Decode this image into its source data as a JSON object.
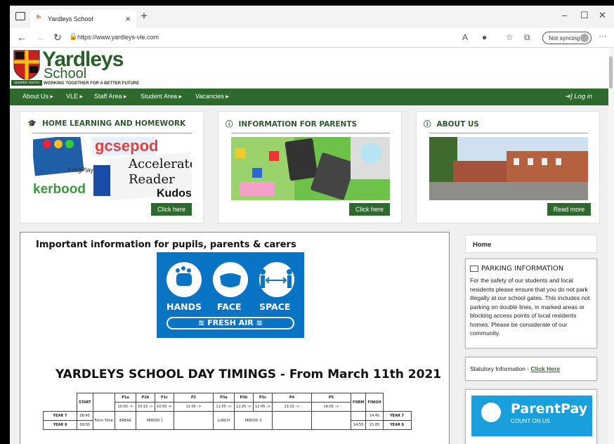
{
  "browser": {
    "tab_title": "Yardleys School",
    "url": "https://www.yardleys-vle.com",
    "sync_label": "Not syncing"
  },
  "site": {
    "brand_line1": "Yardleys",
    "brand_line2": "School",
    "tagline": "WORKING TOGETHER FOR A BETTER FUTURE",
    "motto": "SEMPER TROTH",
    "nav": [
      "About Us ▸",
      "VLE ▸",
      "Staff Area ▸",
      "Student Area ▸",
      "Vacancies ▸"
    ],
    "login": "Log in"
  },
  "cards": [
    {
      "title": "HOME LEARNING AND HOMEWORK",
      "button": "Click here",
      "img_words": [
        "Accelerate",
        "Reader",
        "Kudos",
        "kerbood",
        "FrogPlay",
        "gcsepod"
      ]
    },
    {
      "title": "INFORMATION FOR PARENTS",
      "button": "Click here"
    },
    {
      "title": "ABOUT US",
      "button": "Read more"
    }
  ],
  "main": {
    "heading": "Important information for pupils, parents & carers",
    "covid": {
      "hands": "HANDS",
      "face": "FACE",
      "space": "SPACE",
      "fresh_air": "FRESH AIR"
    },
    "timings_heading": "YARDLEYS SCHOOL DAY TIMINGS - From March 11th 2021",
    "table": {
      "start": "START",
      "form": "FORM",
      "finish": "FINISH",
      "form_time": "Form Time",
      "periods": [
        "P1a",
        "P1b",
        "P1c",
        "P2",
        "P3a",
        "P3b",
        "P3c",
        "P4",
        "P5"
      ],
      "times": [
        "10:00 ->",
        "10:15 ->",
        "10:50 ->",
        "11:05 ->",
        "11:55 ->",
        "12:25 ->",
        "12:45 ->",
        "13:15 ->",
        "14:05 ->"
      ],
      "year7": {
        "label": "YEAR 7",
        "start": "08:45",
        "finish": "14:45",
        "right": "YEAR 7"
      },
      "year8": {
        "label": "YEAR 8",
        "start": "09:00",
        "finish": "15:05",
        "right": "YEAR 8",
        "form_end": "14:55"
      },
      "break": "BREAK",
      "period1": "PERIOD 1",
      "lunch": "LUNCH",
      "period3": "PERIOD 3"
    }
  },
  "sidebar": {
    "home": "Home",
    "parking_title": "PARKING INFORMATION",
    "parking_text": "For the safety of our students and local residents please ensure that you do not park illegally at our school gates. This includes not parking on double lines, in marked areas or blocking access points of local residents homes. Please be considerate of our community.",
    "statutory": "Statutory Information - ",
    "statutory_link": "Click Here",
    "parentpay": "ParentPay",
    "parentpay_sub": "COUNT ON US"
  }
}
